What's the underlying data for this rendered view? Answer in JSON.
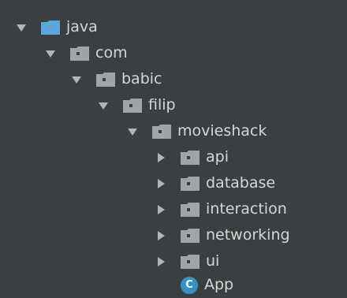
{
  "tree": {
    "items": [
      {
        "label": "java",
        "kind": "source-folder",
        "expanded": true
      },
      {
        "label": "com",
        "kind": "package",
        "expanded": true
      },
      {
        "label": "babic",
        "kind": "package",
        "expanded": true
      },
      {
        "label": "filip",
        "kind": "package",
        "expanded": true
      },
      {
        "label": "movieshack",
        "kind": "package",
        "expanded": true
      },
      {
        "label": "api",
        "kind": "package",
        "expanded": false
      },
      {
        "label": "database",
        "kind": "package",
        "expanded": false
      },
      {
        "label": "interaction",
        "kind": "package",
        "expanded": false
      },
      {
        "label": "networking",
        "kind": "package",
        "expanded": false
      },
      {
        "label": "ui",
        "kind": "package",
        "expanded": false
      },
      {
        "label": "App",
        "kind": "class",
        "badge": "C"
      }
    ]
  },
  "colors": {
    "background": "#3c3f41",
    "folder_gray": "#9fa4a8",
    "source_folder_blue": "#5aa7d8",
    "class_badge": "#3592c4",
    "text": "#d6d6d6"
  }
}
